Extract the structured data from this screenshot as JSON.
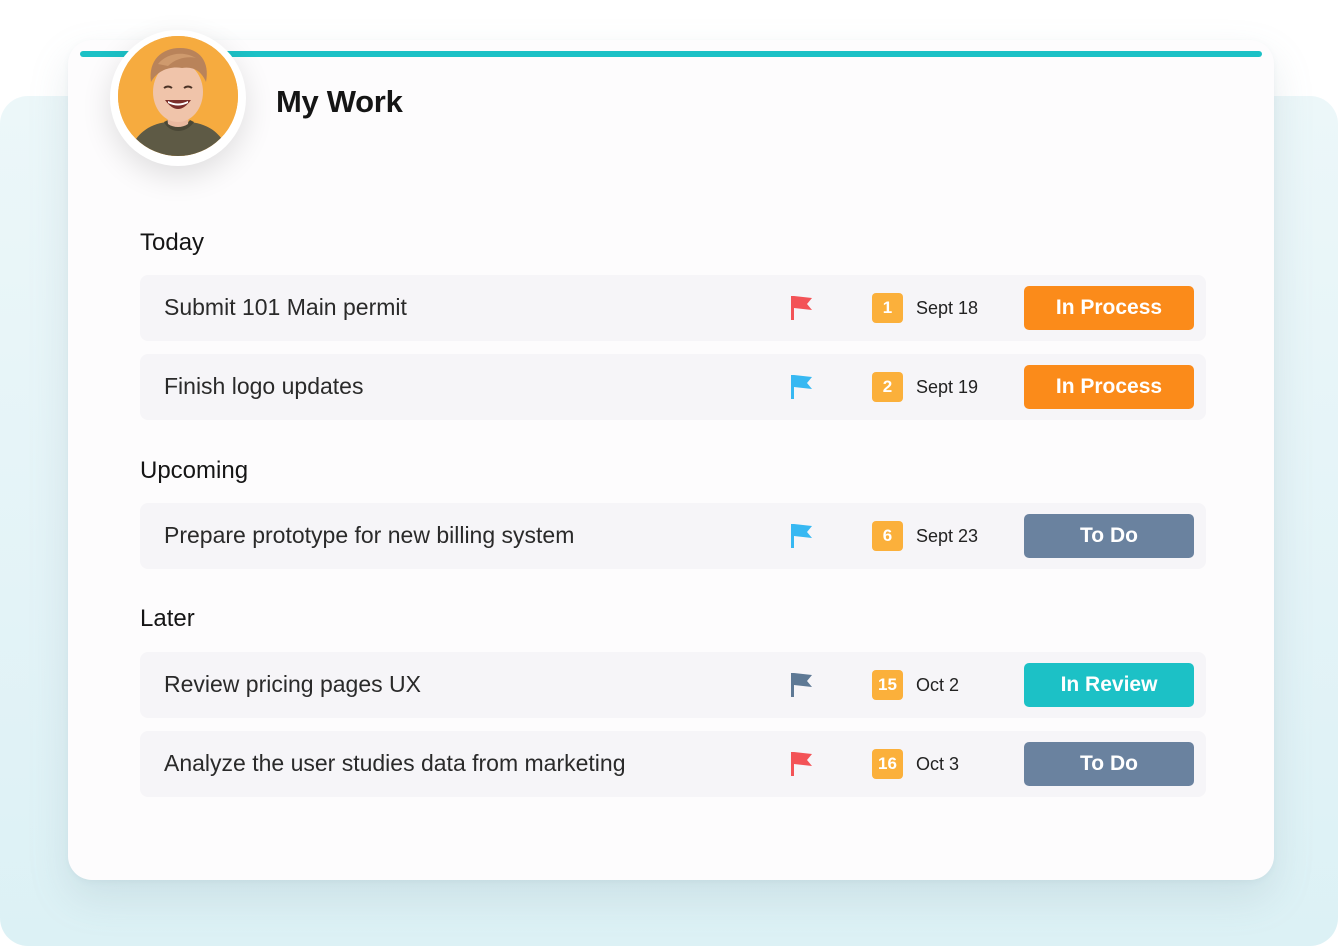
{
  "header": {
    "title": "My Work"
  },
  "colors": {
    "accent": "#1cc1c6",
    "in_process": "#fb8b1a",
    "to_do": "#6a829f",
    "in_review": "#1cc1c6",
    "badge": "#fbb03b",
    "flag_red": "#f35357",
    "flag_blue": "#37b8f2",
    "flag_gray": "#5e7995"
  },
  "sections": [
    {
      "heading": "Today",
      "tasks": [
        {
          "title": "Submit 101 Main permit",
          "flag": "red-flag-icon",
          "number": "1",
          "date": "Sept 18",
          "status": "In Process"
        },
        {
          "title": "Finish logo updates",
          "flag": "blue-flag-icon",
          "number": "2",
          "date": "Sept 19",
          "status": "In Process"
        }
      ]
    },
    {
      "heading": "Upcoming",
      "tasks": [
        {
          "title": "Prepare prototype for new billing system",
          "flag": "blue-flag-icon",
          "number": "6",
          "date": "Sept 23",
          "status": "To Do"
        }
      ]
    },
    {
      "heading": "Later",
      "tasks": [
        {
          "title": "Review pricing pages UX",
          "flag": "gray-flag-icon",
          "number": "15",
          "date": "Oct 2",
          "status": "In Review"
        },
        {
          "title": "Analyze the user studies data from marketing",
          "flag": "red-flag-icon",
          "number": "16",
          "date": "Oct 3",
          "status": "To Do"
        }
      ]
    }
  ]
}
